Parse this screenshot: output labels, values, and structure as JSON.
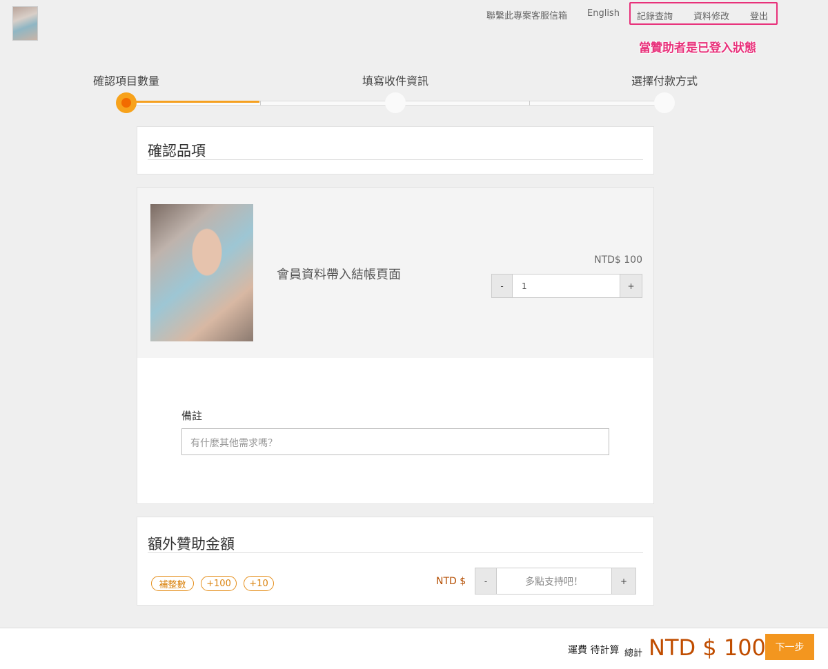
{
  "header": {
    "contact_label": "聯繫此專案客服信箱",
    "language_label": "English",
    "member_links": [
      "記錄查詢",
      "資料修改",
      "登出"
    ],
    "annotation": "當贊助者是已登入狀態"
  },
  "steps": [
    {
      "label": "確認項目數量",
      "state": "active"
    },
    {
      "label": "填寫收件資訊",
      "state": "pending"
    },
    {
      "label": "選擇付款方式",
      "state": "pending"
    }
  ],
  "confirm_section": {
    "title": "確認品項"
  },
  "item": {
    "name": "會員資料帶入結帳頁面",
    "price": "NTD$ 100",
    "quantity": "1",
    "minus_label": "-",
    "plus_label": "+"
  },
  "note": {
    "label": "備註",
    "placeholder": "有什麼其他需求嗎？"
  },
  "extra": {
    "title": "額外贊助金額",
    "chips": [
      "補整數",
      "+100",
      "+10"
    ],
    "currency_label": "NTD $",
    "placeholder": "多點支持吧！",
    "minus_label": "-",
    "plus_label": "+"
  },
  "footer": {
    "shipping": "運費 待計算",
    "total_label": "總計",
    "total_value": "NTD $ 100",
    "next_label": "下一步"
  },
  "colors": {
    "accent": "#f3961f",
    "total": "#c04d00",
    "annotation": "#e8307a"
  }
}
